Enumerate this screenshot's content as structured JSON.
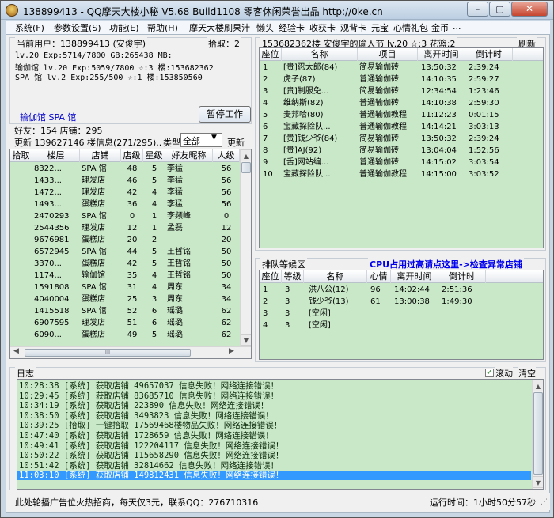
{
  "window": {
    "title": "138899413 - QQ摩天大楼小秘 V5.68 Build1108 零客休闲荣誉出品 http://0ke.cn",
    "minimize": "–",
    "maximize": "▢",
    "close": "✕"
  },
  "menu": [
    "系统(F)",
    "参数设置(S)",
    "功能(E)",
    "帮助(H)",
    "摩天大楼刷果汁",
    "懒头",
    "经验卡",
    "收获卡",
    "观背卡",
    "元宝",
    "心情礼包",
    "金币",
    "..."
  ],
  "user": {
    "title": "当前用户：138899413 (安俊宇)",
    "pickup": "拾取：2",
    "lines": [
      "lv.20    Exp:5714/7800    GB:265438    MB:",
      "输伽馆  lv.20  Exp:5059/7800     ☆:3 楼:153682362",
      "SPA 馆  lv.2   Exp:255/500       ☆:1 楼:153850560"
    ],
    "shops": "输伽馆  SPA 馆",
    "pause_btn": "暂停工作"
  },
  "friends": {
    "title": "好友：154  店铺：295",
    "update_text": "更新 139627146 楼信息(271/295)..",
    "type_label": "类型",
    "type_value": "全部",
    "update_btn": "更新",
    "columns": [
      "拾取",
      "楼层",
      "店铺",
      "店级",
      "星级",
      "好友昵称",
      "人级"
    ],
    "rows": [
      [
        "",
        "8322...",
        "SPA 馆",
        "48",
        "5",
        "李猛",
        "56"
      ],
      [
        "",
        "1433...",
        "理发店",
        "46",
        "5",
        "李猛",
        "56"
      ],
      [
        "",
        "1472...",
        "理发店",
        "42",
        "4",
        "李猛",
        "56"
      ],
      [
        "",
        "1493...",
        "蛋糕店",
        "36",
        "4",
        "李猛",
        "56"
      ],
      [
        "",
        "2470293",
        "SPA 馆",
        "0",
        "1",
        "李频峰",
        "0"
      ],
      [
        "",
        "2544356",
        "理发店",
        "12",
        "1",
        "孟磊",
        "12"
      ],
      [
        "",
        "9676981",
        "蛋糕店",
        "20",
        "2",
        "",
        "20"
      ],
      [
        "",
        "6572945",
        "SPA 馆",
        "44",
        "5",
        "王哲铭",
        "50"
      ],
      [
        "",
        "3370...",
        "蛋糕店",
        "42",
        "5",
        "王哲铭",
        "50"
      ],
      [
        "",
        "1174...",
        "输伽馆",
        "35",
        "4",
        "王哲铭",
        "50"
      ],
      [
        "",
        "1591808",
        "SPA 馆",
        "31",
        "4",
        "周东",
        "34"
      ],
      [
        "",
        "4040004",
        "蛋糕店",
        "25",
        "3",
        "周东",
        "34"
      ],
      [
        "",
        "1415518",
        "SPA 馆",
        "52",
        "6",
        "瑶璐",
        "62"
      ],
      [
        "",
        "6907595",
        "理发店",
        "51",
        "6",
        "瑶璐",
        "62"
      ],
      [
        "",
        "6090...",
        "蛋糕店",
        "49",
        "5",
        "瑶璐",
        "62"
      ]
    ],
    "hscroll_mid": "III"
  },
  "floor": {
    "title": "153682362楼 安俊宇的瑜人节 lv.20 ☆:3 花篮:2",
    "refresh": "刷新",
    "columns": [
      "座位",
      "名称",
      "项目",
      "离开时间",
      "倒计时"
    ],
    "rows": [
      [
        "1",
        "[贵]忍太郎(84)",
        "简易输伽砖",
        "13:50:32",
        "2:39:24"
      ],
      [
        "2",
        "虎子(87)",
        "普通输伽砖",
        "14:10:35",
        "2:59:27"
      ],
      [
        "3",
        "[贵]制服免...",
        "简易输伽砖",
        "12:34:54",
        "1:23:46"
      ],
      [
        "4",
        "维纳斯(82)",
        "普通输伽砖",
        "14:10:38",
        "2:59:30"
      ],
      [
        "5",
        "麦邦哈(80)",
        "普通输伽教程",
        "11:12:23",
        "0:01:15"
      ],
      [
        "6",
        "宝藏探险队...",
        "普通输伽教程",
        "14:14:21",
        "3:03:13"
      ],
      [
        "7",
        "[贵]钱少爷(84)",
        "简易输伽砖",
        "13:50:32",
        "2:39:24"
      ],
      [
        "8",
        "[贵]AJ(92)",
        "简易输伽砖",
        "13:04:04",
        "1:52:56"
      ],
      [
        "9",
        "[舌]网站编...",
        "普通输伽砖",
        "14:15:02",
        "3:03:54"
      ],
      [
        "10",
        "宝藏探险队...",
        "普通输伽教程",
        "14:15:00",
        "3:03:52"
      ]
    ]
  },
  "queue": {
    "title": "排队等候区",
    "cpu_link": "CPU占用过高请点这里->检查异常店铺",
    "columns": [
      "座位",
      "等级",
      "名称",
      "心情",
      "离开时间",
      "倒计时"
    ],
    "rows": [
      [
        "1",
        "3",
        "洪八公(12)",
        "96",
        "14:02:44",
        "2:51:36"
      ],
      [
        "2",
        "3",
        "钱少爷(13)",
        "61",
        "13:00:38",
        "1:49:30"
      ],
      [
        "3",
        "3",
        "[空闲]",
        "",
        "",
        ""
      ],
      [
        "4",
        "3",
        "[空闲]",
        "",
        "",
        ""
      ]
    ]
  },
  "log": {
    "title": "日志",
    "scroll_label": "滚动",
    "clear_label": "清空",
    "lines": [
      "10:28:38 [系统] 获取店铺 49657037 信息失败！网络连接错误！",
      "10:29:45 [系统] 获取店铺 83685710 信息失败！网络连接错误！",
      "10:34:19 [系统] 获取店铺 223890 信息失败！网络连接错误！",
      "10:38:50 [系统] 获取店铺 3493823 信息失败！网络连接错误！",
      "10:39:25 [拾取] 一键拾取 17569468楼物品失败！网络连接错误！",
      "10:47:40 [系统] 获取店铺 1728659 信息失败！网络连接错误！",
      "10:49:41 [系统] 获取店铺 122204117 信息失败！网络连接错误！",
      "10:50:22 [系统] 获取店铺 115658290 信息失败！网络连接错误！",
      "10:51:42 [系统] 获取店铺 32814662 信息失败！网络连接错误！",
      "11:03:10 [系统] 获取店铺 149812431 信息失败！网络连接错误！"
    ]
  },
  "status": {
    "ad": "此处轮播广告位火热招商，每天仅3元，联系QQ：276710316",
    "runtime": "运行时间：1小时50分57秒"
  }
}
